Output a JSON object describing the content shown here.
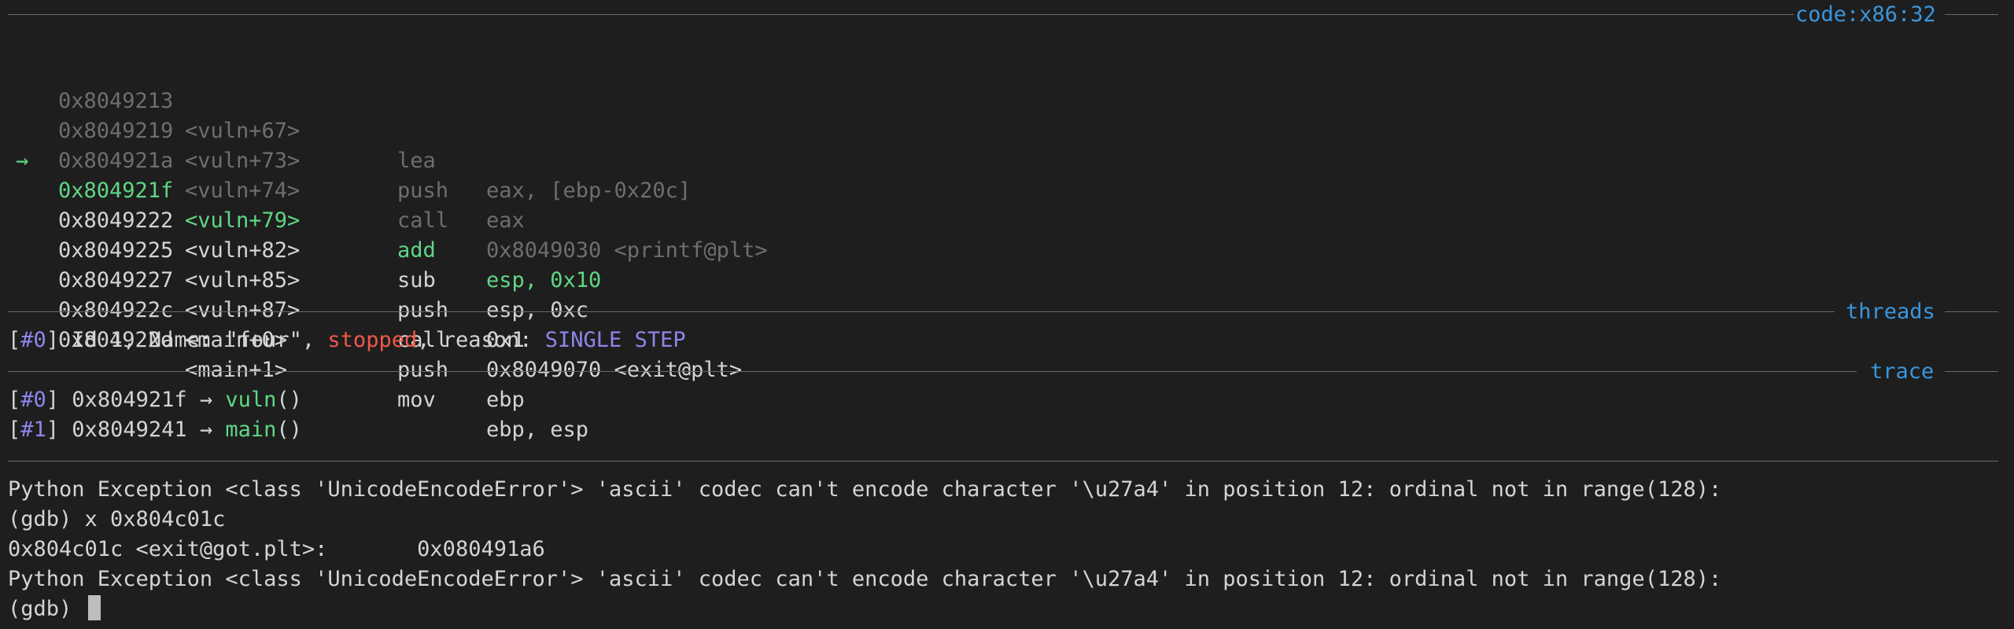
{
  "code_section": {
    "title": "code:x86:32",
    "rows": [
      {
        "arrow": "",
        "addr": "0x8049213",
        "sym": "<vuln+67>",
        "mnem": "lea",
        "ops": "eax, [ebp-0x20c]",
        "state": "past"
      },
      {
        "arrow": "",
        "addr": "0x8049219",
        "sym": "<vuln+73>",
        "mnem": "push",
        "ops": "eax",
        "state": "past"
      },
      {
        "arrow": "",
        "addr": "0x804921a",
        "sym": "<vuln+74>",
        "mnem": "call",
        "ops": "0x8049030 <printf@plt>",
        "state": "past"
      },
      {
        "arrow": "→",
        "addr": "0x804921f",
        "sym": "<vuln+79>",
        "mnem": "add",
        "ops": "esp, 0x10",
        "state": "current"
      },
      {
        "arrow": "",
        "addr": "0x8049222",
        "sym": "<vuln+82>",
        "mnem": "sub",
        "ops": "esp, 0xc",
        "state": "normal"
      },
      {
        "arrow": "",
        "addr": "0x8049225",
        "sym": "<vuln+85>",
        "mnem": "push",
        "ops": "0x1",
        "state": "normal"
      },
      {
        "arrow": "",
        "addr": "0x8049227",
        "sym": "<vuln+87>",
        "mnem": "call",
        "ops": "0x8049070 <exit@plt>",
        "state": "normal"
      },
      {
        "arrow": "",
        "addr": "0x804922c",
        "sym": "<main+0>",
        "mnem": "push",
        "ops": "ebp",
        "state": "normal"
      },
      {
        "arrow": "",
        "addr": "0x804922d",
        "sym": "<main+1>",
        "mnem": "mov",
        "ops": "ebp, esp",
        "state": "normal"
      }
    ]
  },
  "threads_section": {
    "title": "threads",
    "thread": {
      "index": "#0",
      "prefix": " Id 1, Name: \"four\", ",
      "state": "stopped",
      "mid": ", reason: ",
      "reason": "SINGLE STEP"
    }
  },
  "trace_section": {
    "title": "trace",
    "frames": [
      {
        "index": "#0",
        "addr": " 0x804921f → ",
        "func": "vuln",
        "suffix": "()"
      },
      {
        "index": "#1",
        "addr": " 0x8049241 → ",
        "func": "main",
        "suffix": "()"
      }
    ]
  },
  "console": {
    "lines": [
      "Python Exception <class 'UnicodeEncodeError'> 'ascii' codec can't encode character '\\u27a4' in position 12: ordinal not in range(128):",
      "(gdb) x 0x804c01c",
      "0x804c01c <exit@got.plt>:\t0x080491a6",
      "Python Exception <class 'UnicodeEncodeError'> 'ascii' codec can't encode character '\\u27a4' in position 12: ordinal not in range(128):"
    ],
    "prompt": "(gdb) "
  },
  "colors": {
    "background": "#1e1e1e",
    "section_title": "#3a96dd",
    "current_instruction": "#5fd785",
    "past_instruction": "#6e6e6e",
    "stopped": "#f0584a",
    "index": "#8e86ea"
  }
}
